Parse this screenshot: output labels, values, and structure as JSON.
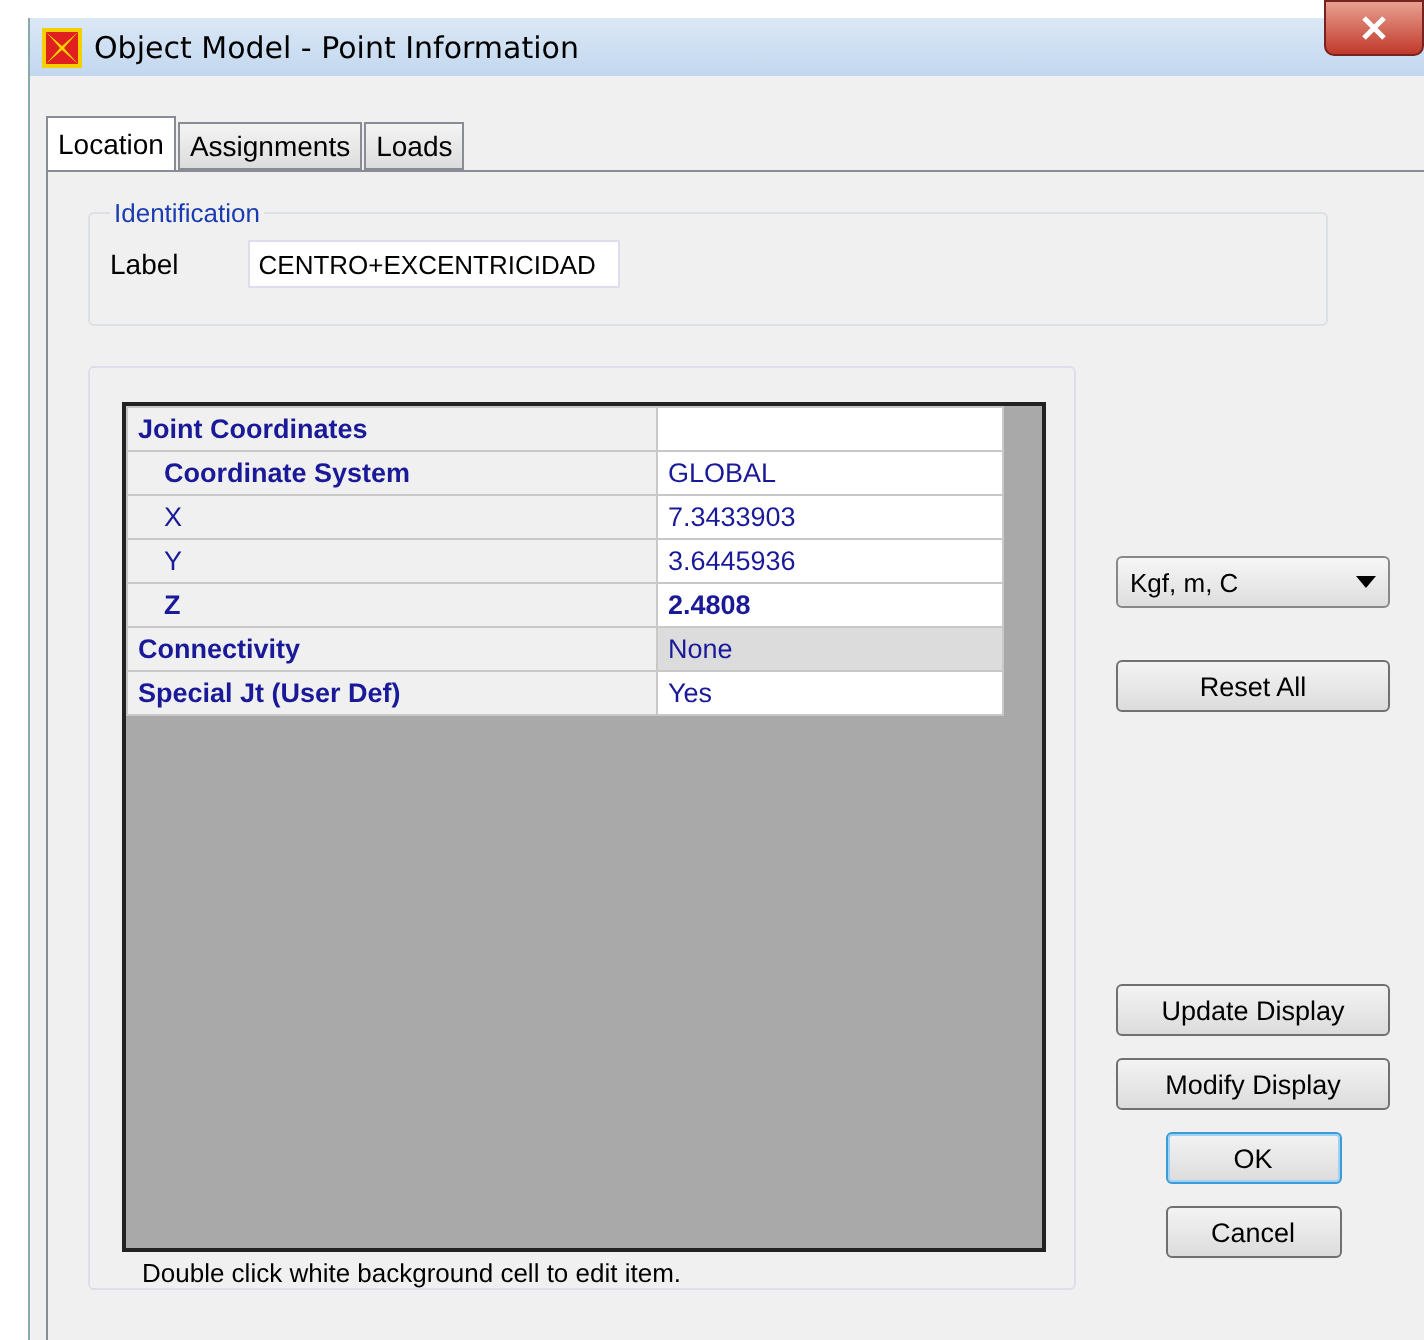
{
  "window": {
    "title": "Object Model - Point Information"
  },
  "tabs": [
    {
      "label": "Location",
      "selected": true
    },
    {
      "label": "Assignments",
      "selected": false
    },
    {
      "label": "Loads",
      "selected": false
    }
  ],
  "identification": {
    "legend": "Identification",
    "label": "Label",
    "value": "CENTRO+EXCENTRICIDAD"
  },
  "grid": {
    "rows": [
      {
        "label": "Joint Coordinates",
        "value": "",
        "label_bold": true,
        "value_bold": false,
        "editable": true,
        "children": [
          {
            "label": "Coordinate System",
            "value": "GLOBAL",
            "label_bold": true,
            "value_bold": false,
            "editable": true
          },
          {
            "label": "X",
            "value": "7.3433903",
            "label_bold": false,
            "value_bold": false,
            "editable": true
          },
          {
            "label": "Y",
            "value": "3.6445936",
            "label_bold": false,
            "value_bold": false,
            "editable": true
          },
          {
            "label": "Z",
            "value": "2.4808",
            "label_bold": true,
            "value_bold": true,
            "editable": true
          }
        ]
      },
      {
        "label": "Connectivity",
        "value": "None",
        "label_bold": true,
        "value_bold": false,
        "editable": false
      },
      {
        "label": "Special Jt (User Def)",
        "value": "Yes",
        "label_bold": true,
        "value_bold": false,
        "editable": true
      }
    ],
    "hint": "Double click white background cell to edit item."
  },
  "units": {
    "value": "Kgf, m, C"
  },
  "buttons": [
    {
      "label": "Reset All",
      "kind": "wide"
    },
    {
      "label": "Update Display",
      "kind": "wide"
    },
    {
      "label": "Modify Display",
      "kind": "wide"
    },
    {
      "label": "OK",
      "kind": "default"
    },
    {
      "label": "Cancel",
      "kind": "narrow"
    }
  ]
}
